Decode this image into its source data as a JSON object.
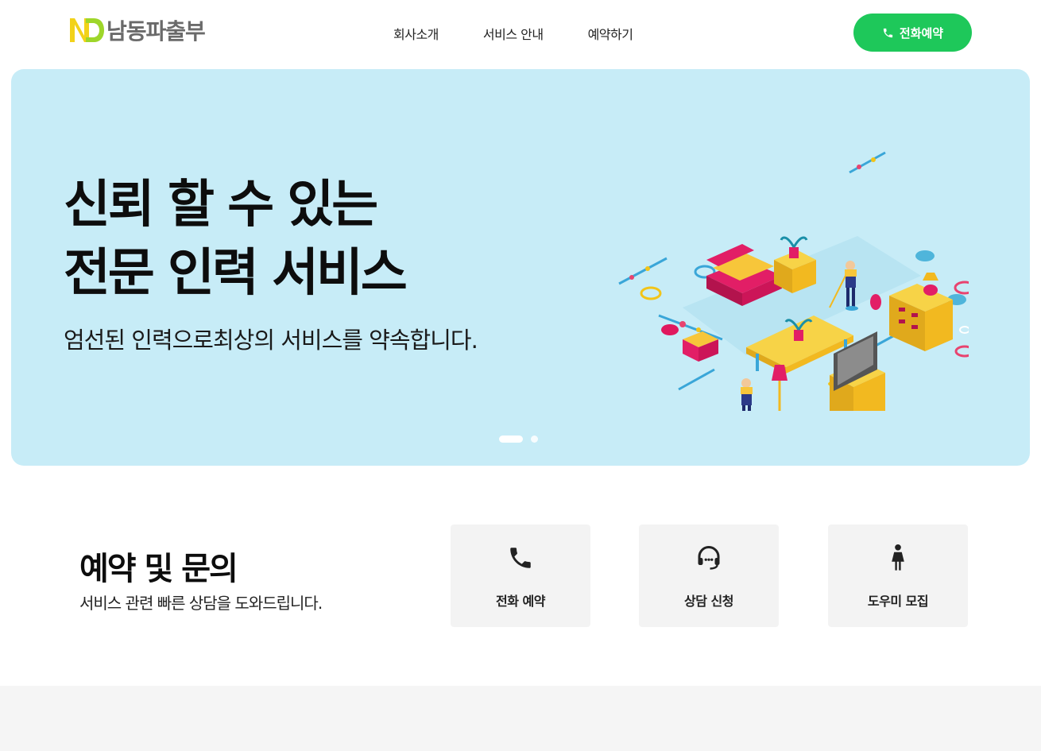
{
  "header": {
    "logo_text": "남동파출부",
    "nav": [
      "회사소개",
      "서비스 안내",
      "예약하기"
    ],
    "call_button_label": "전화예약"
  },
  "hero": {
    "title_line1": "신뢰 할 수 있는",
    "title_line2": "전문 인력 서비스",
    "subtitle": "엄선된 인력으로최상의 서비스를 약속합니다.",
    "slide_count": 2,
    "active_slide": 1
  },
  "contact": {
    "title": "예약 및 문의",
    "subtitle": "서비스 관련 빠른 상담을 도와드립니다.",
    "cards": [
      {
        "label": "전화 예약",
        "icon": "phone-icon"
      },
      {
        "label": "상담 신청",
        "icon": "headset-icon"
      },
      {
        "label": "도우미 모집",
        "icon": "person-icon"
      }
    ]
  },
  "colors": {
    "accent_green": "#1ec85a",
    "hero_bg": "#c7ecf7",
    "card_bg": "#f3f3f3"
  }
}
